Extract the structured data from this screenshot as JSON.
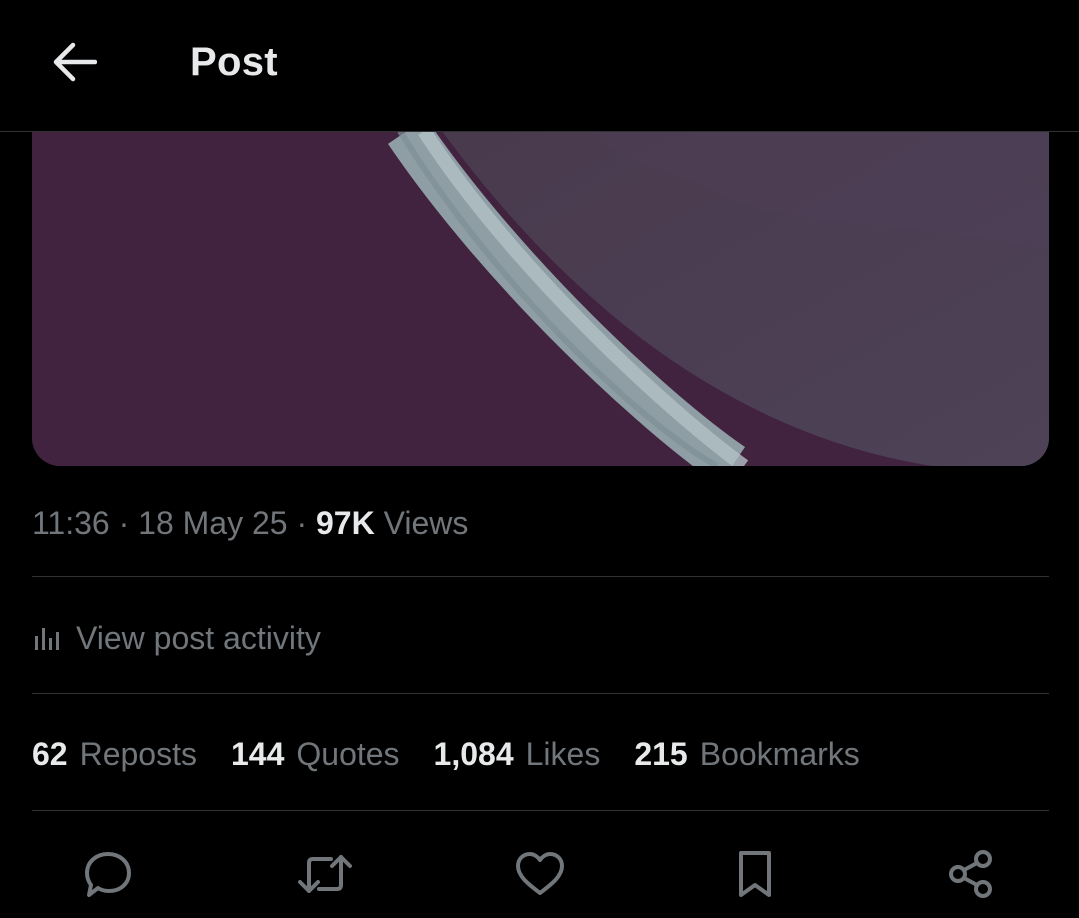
{
  "header": {
    "title": "Post",
    "back_icon": "arrow-left-icon"
  },
  "media": {
    "description_colors": {
      "background_left": "#41223f",
      "background_right": "#4b3d52",
      "ring": "#9aa9ae"
    }
  },
  "post_meta": {
    "time": "11:36",
    "separator": "·",
    "date": "18 May 25",
    "views_count": "97K",
    "views_label": "Views"
  },
  "activity": {
    "icon": "bar-chart-icon",
    "label": "View post activity"
  },
  "stats": [
    {
      "count": "62",
      "label": "Reposts"
    },
    {
      "count": "144",
      "label": "Quotes"
    },
    {
      "count": "1,084",
      "label": "Likes"
    },
    {
      "count": "215",
      "label": "Bookmarks"
    }
  ],
  "actions": [
    "reply-icon",
    "repost-icon",
    "like-icon",
    "bookmark-icon",
    "share-icon"
  ],
  "colors": {
    "background": "#000000",
    "primary_text": "#e7e9ea",
    "secondary_text": "#71767b",
    "divider": "#2f3336"
  }
}
